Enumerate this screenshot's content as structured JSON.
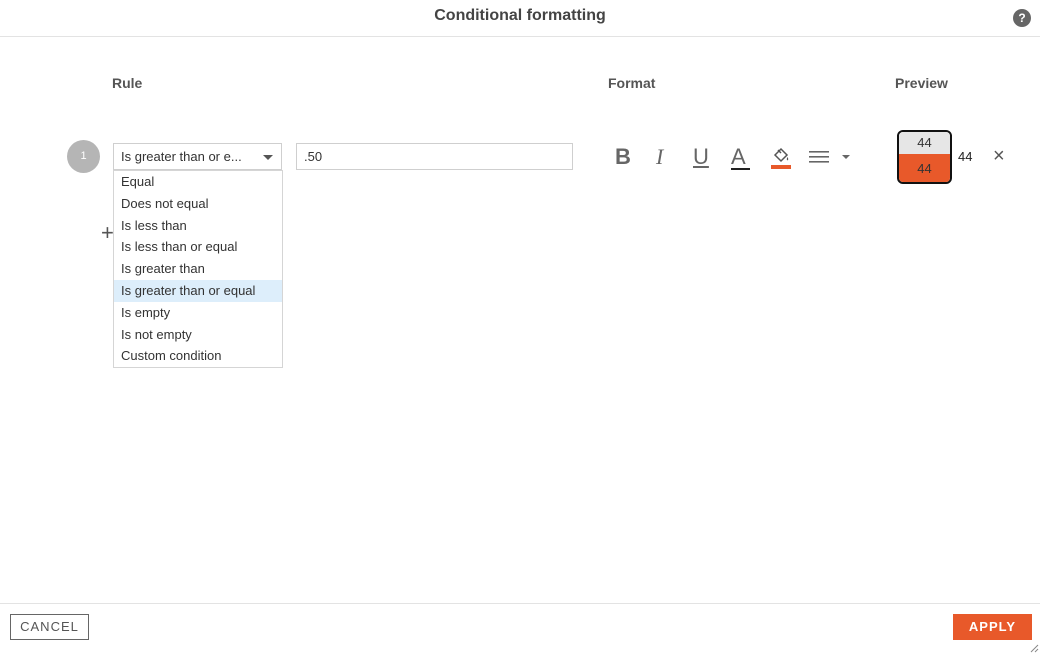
{
  "dialog": {
    "title": "Conditional formatting",
    "help_icon": "question-circle-icon",
    "help_label": "?"
  },
  "columns": {
    "rule": "Rule",
    "format": "Format",
    "preview": "Preview"
  },
  "rule": {
    "number": "1",
    "condition_selected": "Is greater than or e...",
    "value": ".50",
    "options": [
      "Equal",
      "Does not equal",
      "Is less than",
      "Is less than or equal",
      "Is greater than",
      "Is greater than or equal",
      "Is empty",
      "Is not empty",
      "Custom condition"
    ],
    "highlighted_option": "Is greater than or equal"
  },
  "format": {
    "bold_label": "B",
    "italic_label": "I",
    "underline_label": "U",
    "text_color_label": "A",
    "fill_color": "#e8592a",
    "icons": [
      "bold-icon",
      "italic-icon",
      "underline-icon",
      "text-color-icon",
      "fill-color-icon",
      "align-icon"
    ]
  },
  "preview": {
    "top_value": "44",
    "formatted_value": "44",
    "plain_value": "44",
    "remove_label": "×"
  },
  "add_label": "+",
  "buttons": {
    "cancel": "CANCEL",
    "apply": "APPLY"
  },
  "colors": {
    "accent": "#e8592a",
    "highlight": "#ddeefb"
  }
}
